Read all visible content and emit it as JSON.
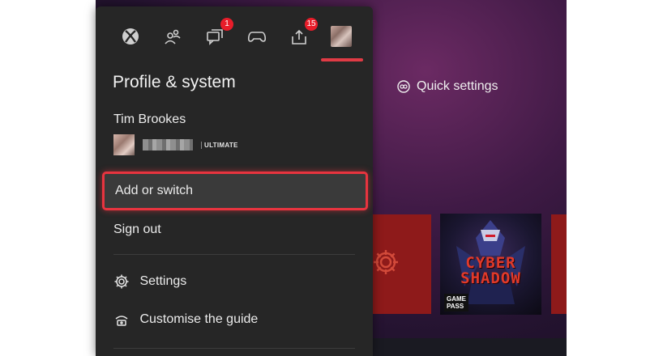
{
  "guide": {
    "tabs": [
      {
        "id": "xbox",
        "icon": "xbox-logo-icon",
        "badge": ""
      },
      {
        "id": "people",
        "icon": "people-icon",
        "badge": ""
      },
      {
        "id": "chat",
        "icon": "chat-icon",
        "badge": "1"
      },
      {
        "id": "controller",
        "icon": "controller-icon",
        "badge": ""
      },
      {
        "id": "upload",
        "icon": "upload-icon",
        "badge": "15"
      },
      {
        "id": "profile",
        "icon": "profile-avatar",
        "badge": ""
      }
    ],
    "active_tab": "profile",
    "title": "Profile & system",
    "user": {
      "name": "Tim Brookes",
      "tier": "ULTIMATE"
    },
    "menu": {
      "add_switch": "Add or switch",
      "sign_out": "Sign out",
      "settings": "Settings",
      "customise": "Customise the guide"
    }
  },
  "background": {
    "quick_settings": "Quick settings",
    "game_tile": {
      "title_line1": "CYBER",
      "title_line2": "SHADOW",
      "badge_line1": "GAME",
      "badge_line2": "PASS"
    }
  },
  "colors": {
    "accent": "#e8343f",
    "badge": "#e81d2a",
    "panel": "#262626"
  }
}
